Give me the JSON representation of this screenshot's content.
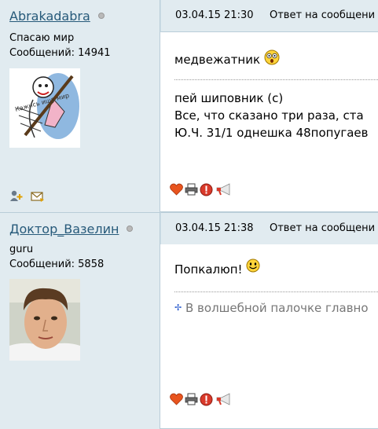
{
  "posts": [
    {
      "username": "Abrakadabra",
      "rank": "Спасаю мир",
      "messages": "Сообщений: 14941",
      "date": "03.04.15 21:30",
      "reply": "Ответ на сообщени",
      "text": "медвежатник",
      "signature": [
        "пей шиповник (с)",
        "Все, что сказано три раза, ста",
        "Ю.Ч. 31/1 однешка 48попугаев"
      ],
      "avatar_caption": "Кажись ищу мир",
      "side_icons": [
        "add-friend-icon",
        "send-message-icon"
      ]
    },
    {
      "username": "Доктор_Вазелин",
      "rank": "guru",
      "messages": "Сообщений: 5858",
      "date": "03.04.15 21:38",
      "reply": "Ответ на сообщени",
      "text": "Попкалюп!",
      "signature_line": "В волшебной палочке главно"
    }
  ],
  "action_icons": [
    "heart-icon",
    "print-icon",
    "report-icon",
    "megaphone-icon"
  ],
  "colors": {
    "header_bg": "#e1ebf0",
    "border": "#b9cdd8",
    "username": "#275a7a",
    "report": "#d93a2b"
  }
}
